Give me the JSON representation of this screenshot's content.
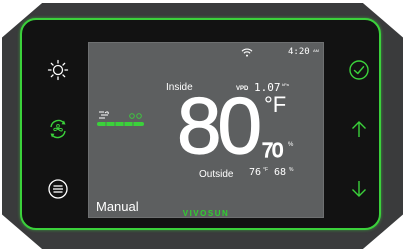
{
  "device": {
    "accent_color": "#3bd13b",
    "left_buttons": [
      {
        "icon": "sun-icon"
      },
      {
        "icon": "fan-cycle-icon"
      },
      {
        "icon": "menu-icon"
      }
    ],
    "right_buttons": [
      {
        "icon": "confirm-check-icon"
      },
      {
        "icon": "arrow-up-icon"
      },
      {
        "icon": "arrow-down-icon"
      }
    ]
  },
  "screen": {
    "wifi_icon": "wifi-icon",
    "time": "4:20",
    "time_suffix": "AM",
    "inside_label": "Inside",
    "vpd_label": "VPD",
    "vpd_value": "1.07",
    "vpd_unit": "kPa",
    "inside_temp": "80",
    "temp_unit": "°F",
    "inside_humidity": "70",
    "humidity_unit": "%",
    "outside_label": "Outside",
    "outside_temp": "76",
    "outside_temp_unit": "°F",
    "outside_humidity": "68",
    "outside_humidity_unit": "%",
    "fan_icon": "fan-speed-icon",
    "mode": "Manual",
    "brand": "VIVOSUN"
  }
}
